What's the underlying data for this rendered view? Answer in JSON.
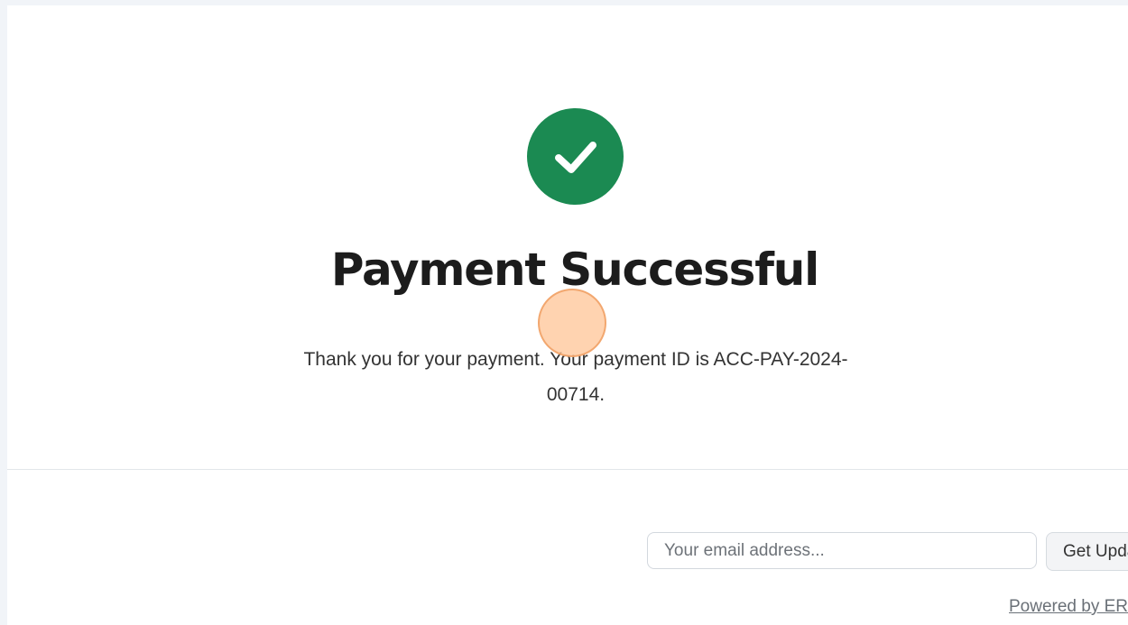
{
  "main": {
    "status_icon": "check-circle-icon",
    "title": "Payment Successful",
    "message": "Thank you for your payment. Your payment ID is ACC-PAY-2024-00714."
  },
  "footer": {
    "email_placeholder": "Your email address...",
    "subscribe_label": "Get Updates",
    "powered_by": "Powered by ERPNext"
  },
  "colors": {
    "success": "#1b8a52",
    "title": "#1c1c1c",
    "background": "#f1f4f8"
  }
}
